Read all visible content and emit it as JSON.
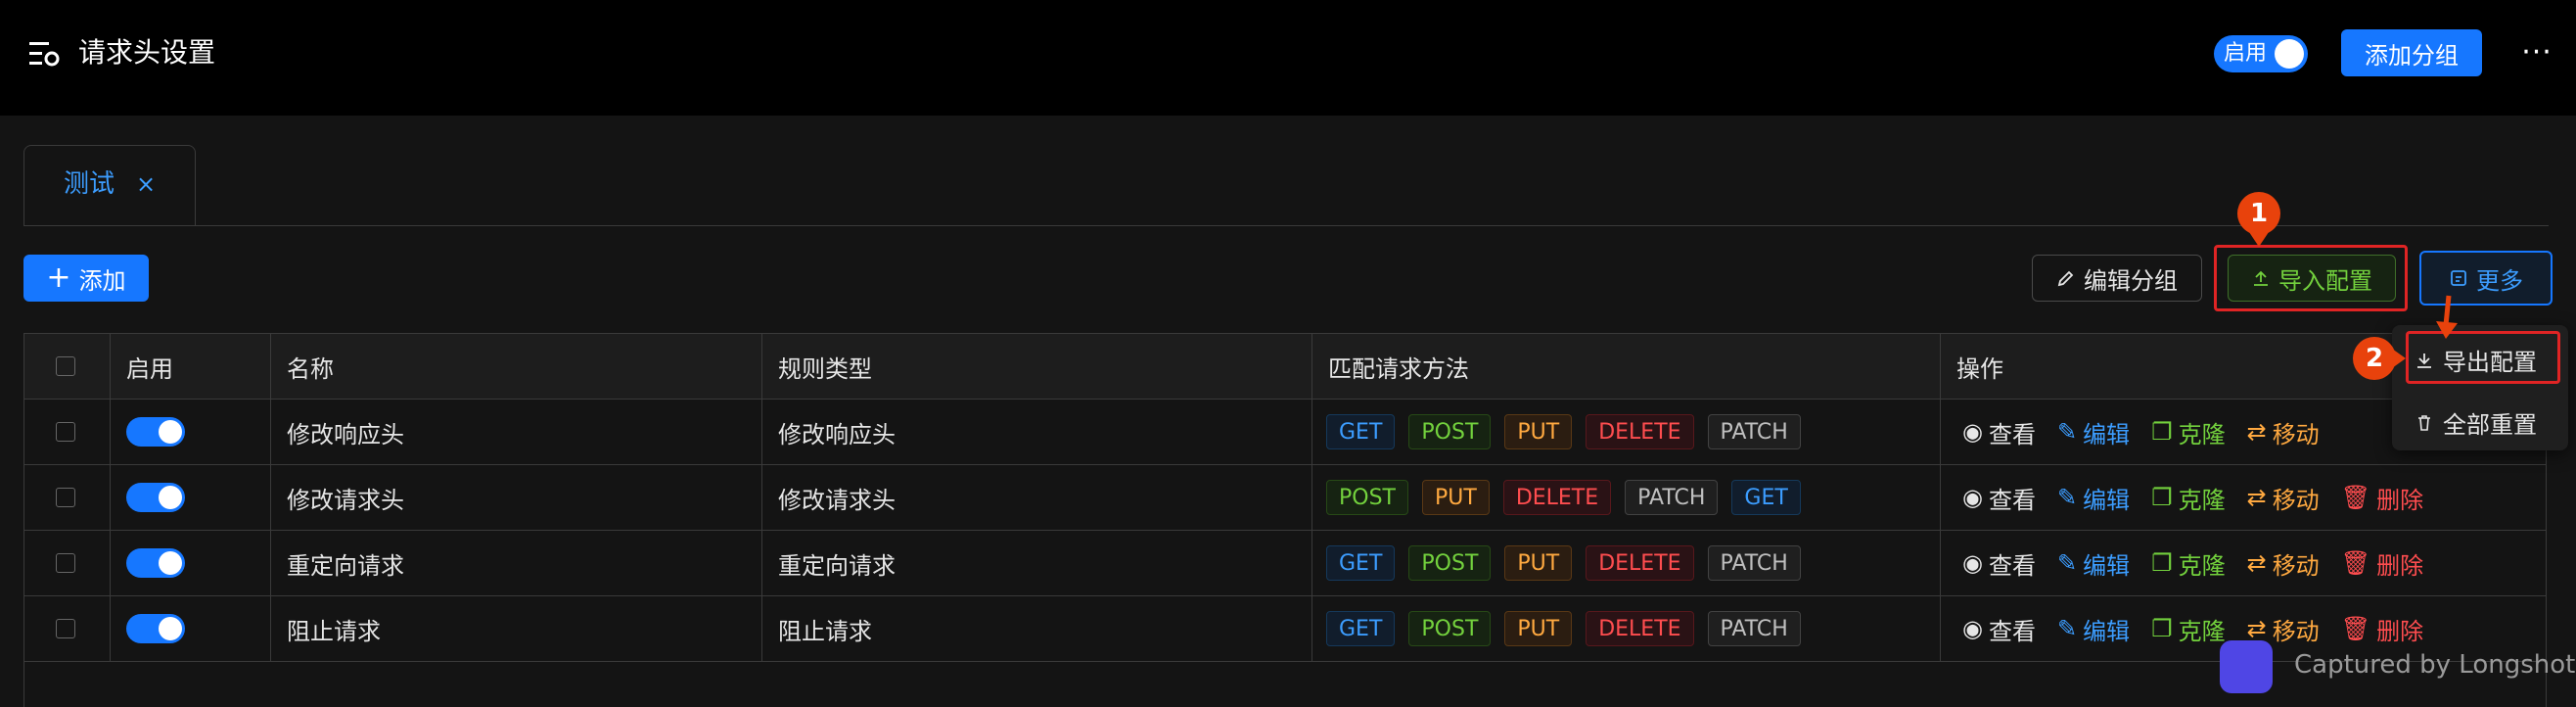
{
  "header": {
    "title": "请求头设置",
    "enable_label": "启用",
    "add_group_label": "添加分组",
    "more_label": "···"
  },
  "tabs": [
    {
      "label": "测试",
      "close": "×"
    }
  ],
  "toolbar": {
    "add_label": "添加",
    "edit_group_label": "编辑分组",
    "import_label": "导入配置",
    "more_label": "更多"
  },
  "dropdown": {
    "items": [
      {
        "label": "导出配置",
        "icon": "download-icon"
      },
      {
        "label": "全部重置",
        "icon": "trash-icon"
      }
    ]
  },
  "annotations": {
    "step1": "1",
    "step2": "2"
  },
  "table": {
    "columns": [
      "启用",
      "名称",
      "规则类型",
      "匹配请求方法",
      "操作"
    ],
    "rows": [
      {
        "name": "修改响应头",
        "type": "修改响应头",
        "methods": [
          "GET",
          "POST",
          "PUT",
          "DELETE",
          "PATCH"
        ]
      },
      {
        "name": "修改请求头",
        "type": "修改请求头",
        "methods": [
          "POST",
          "PUT",
          "DELETE",
          "PATCH",
          "GET"
        ]
      },
      {
        "name": "重定向请求",
        "type": "重定向请求",
        "methods": [
          "GET",
          "POST",
          "PUT",
          "DELETE",
          "PATCH"
        ]
      },
      {
        "name": "阻止请求",
        "type": "阻止请求",
        "methods": [
          "GET",
          "POST",
          "PUT",
          "DELETE",
          "PATCH"
        ]
      }
    ],
    "actions": {
      "view": "查看",
      "edit": "编辑",
      "clone": "克隆",
      "move": "移动",
      "delete": "删除"
    }
  },
  "watermark": "Captured by Longshot",
  "colors": {
    "accent": "#1677ff",
    "highlight": "#e02424",
    "badge": "#e8420c"
  }
}
